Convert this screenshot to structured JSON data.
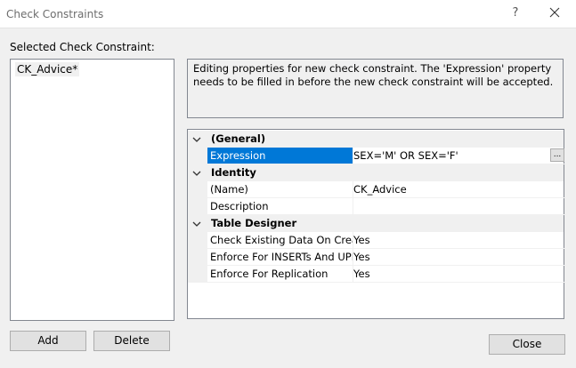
{
  "window": {
    "title": "Check Constraints",
    "help_label": "?"
  },
  "selected_label": "Selected Check Constraint:",
  "constraints": [
    "CK_Advice*"
  ],
  "description": "Editing properties for new check constraint.  The 'Expression' property needs to be filled in before the new check constraint will be accepted.",
  "properties": {
    "general": {
      "label": "(General)",
      "expression_name": "Expression",
      "expression_value": "SEX='M' OR SEX='F'",
      "ellipsis_label": "..."
    },
    "identity": {
      "label": "Identity",
      "name_name": "(Name)",
      "name_value": "CK_Advice",
      "description_name": "Description",
      "description_value": ""
    },
    "table_designer": {
      "label": "Table Designer",
      "check_existing_name": "Check Existing Data On Creat",
      "check_existing_value": "Yes",
      "enforce_inserts_name": "Enforce For INSERTs And UPD.",
      "enforce_inserts_value": "Yes",
      "enforce_replication_name": "Enforce For Replication",
      "enforce_replication_value": "Yes"
    }
  },
  "buttons": {
    "add": "Add",
    "delete": "Delete",
    "close": "Close"
  }
}
